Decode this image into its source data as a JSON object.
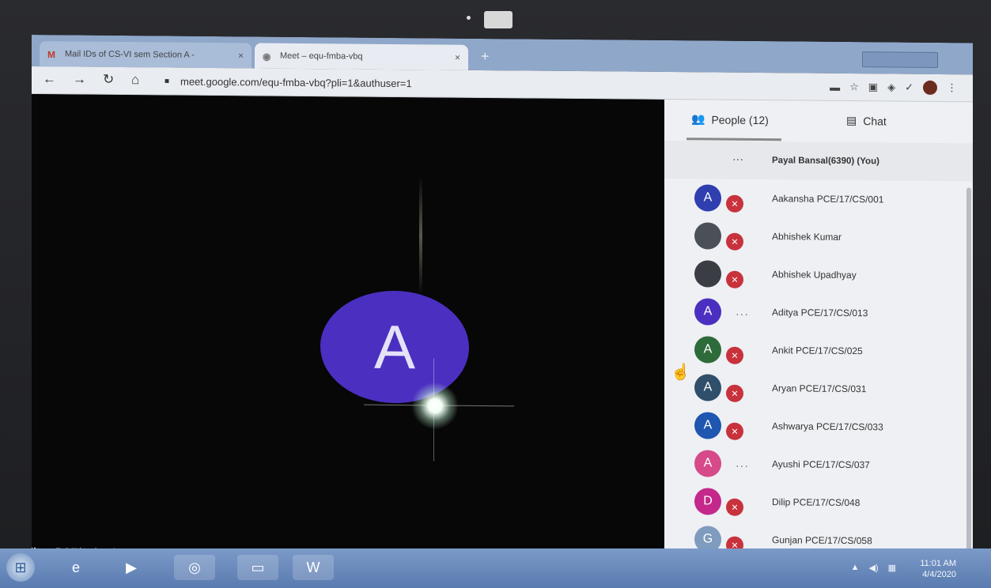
{
  "browser": {
    "tabs": [
      {
        "favicon": "gmail-icon",
        "label": "Mail IDs of CS-VI sem Section A -",
        "close": "×"
      },
      {
        "favicon": "meet-icon",
        "label": "Meet – equ-fmba-vbq",
        "close": "×"
      }
    ],
    "new_tab": "+",
    "url": "meet.google.com/equ-fmba-vbq?pli=1&authuser=1"
  },
  "stage": {
    "avatar_letter": "A",
    "avatar_color": "#4b2fc0",
    "speaker_name": "Aditya PCE/17/CS/013"
  },
  "panel": {
    "people_tab": "People (12)",
    "chat_tab": "Chat",
    "people": [
      {
        "letter": "",
        "name": "Payal Bansal(6390) (You)",
        "color": "",
        "status": "you"
      },
      {
        "letter": "A",
        "name": "Aakansha PCE/17/CS/001",
        "color": "#2f3fb0",
        "status": "muted"
      },
      {
        "letter": "",
        "name": "Abhishek Kumar",
        "color": "#4a4f58",
        "status": "muted"
      },
      {
        "letter": "",
        "name": "Abhishek Upadhyay",
        "color": "#3a3d44",
        "status": "muted"
      },
      {
        "letter": "A",
        "name": "Aditya PCE/17/CS/013",
        "color": "#4b2fc0",
        "status": "more"
      },
      {
        "letter": "A",
        "name": "Ankit PCE/17/CS/025",
        "color": "#2e6b3a",
        "status": "muted"
      },
      {
        "letter": "A",
        "name": "Aryan PCE/17/CS/031",
        "color": "#2f4f6a",
        "status": "muted"
      },
      {
        "letter": "A",
        "name": "Ashwarya PCE/17/CS/033",
        "color": "#1e56b0",
        "status": "muted"
      },
      {
        "letter": "A",
        "name": "Ayushi PCE/17/CS/037",
        "color": "#d64a8a",
        "status": "more"
      },
      {
        "letter": "D",
        "name": "Dilip PCE/17/CS/048",
        "color": "#c3288a",
        "status": "muted"
      },
      {
        "letter": "G",
        "name": "Gunjan PCE/17/CS/058",
        "color": "#7f9bbd",
        "status": "muted"
      }
    ]
  },
  "taskbar": {
    "apps": [
      "ie-icon",
      "media-player-icon",
      "chrome-icon",
      "explorer-icon",
      "word-icon"
    ],
    "time": "11:01 AM",
    "date": "4/4/2020"
  }
}
